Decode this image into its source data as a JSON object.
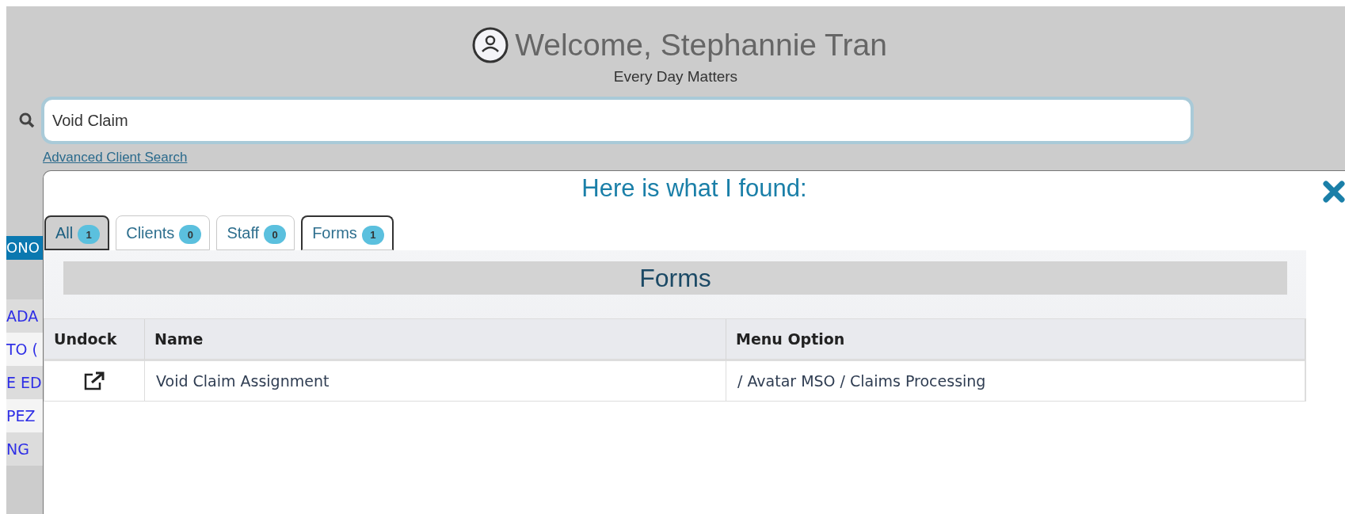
{
  "header": {
    "welcome": "Welcome, Stephannie Tran",
    "tagline": "Every Day Matters"
  },
  "search": {
    "value": "Void Claim",
    "advanced_link": "Advanced Client Search"
  },
  "background_list": {
    "band": "ONO",
    "items": [
      "ADA",
      "TO (",
      "E ED",
      "PEZ",
      "NG"
    ]
  },
  "results": {
    "title": "Here is what I found:",
    "tabs": [
      {
        "label": "All",
        "count": "1",
        "selected": true,
        "focused": false
      },
      {
        "label": "Clients",
        "count": "0",
        "selected": false,
        "focused": false
      },
      {
        "label": "Staff",
        "count": "0",
        "selected": false,
        "focused": false
      },
      {
        "label": "Forms",
        "count": "1",
        "selected": false,
        "focused": true
      }
    ],
    "section": {
      "title": "Forms",
      "columns": [
        "Undock",
        "Name",
        "Menu Option"
      ],
      "rows": [
        {
          "name": "Void Claim Assignment",
          "menu_option": "/ Avatar MSO / Claims Processing"
        }
      ]
    }
  }
}
